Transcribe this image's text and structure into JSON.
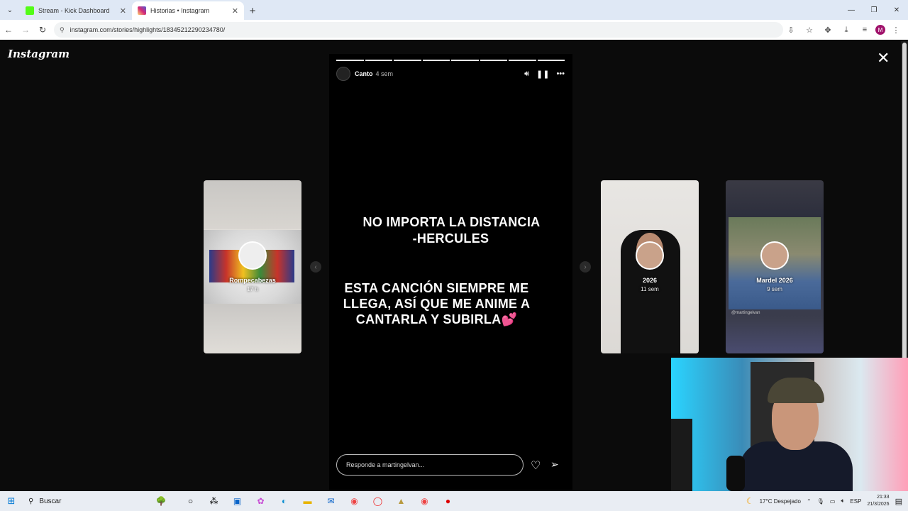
{
  "browser": {
    "tabs": [
      {
        "title": "Stream - Kick Dashboard",
        "favicon_color": "#53fc18"
      },
      {
        "title": "Historias • Instagram",
        "favicon_color": "#e1306c"
      }
    ],
    "url": "instagram.com/stories/highlights/18345212290234780/"
  },
  "instagram": {
    "logo": "Instagram",
    "story": {
      "username": "Canto",
      "time": "4 sem",
      "text_line1": "NO IMPORTA LA DISTANCIA",
      "text_line2": "-HERCULES",
      "text_line3": "ESTA CANCIÓN SIEMPRE ME",
      "text_line4": "LLEGA, ASÍ QUE ME ANIME A",
      "text_line5": "CANTARLA Y SUBIRLA💕",
      "reply_placeholder": "Responde a martingelvan...",
      "segments_total": 8,
      "segments_done": 8
    },
    "previews": [
      {
        "label": "Rompecabezas",
        "time": "17 h"
      },
      {
        "label": "2026",
        "time": "11 sem"
      },
      {
        "label": "Mardel 2026",
        "time": "9 sem",
        "caption": "@martingelvan"
      }
    ]
  },
  "taskbar": {
    "search_label": "Buscar",
    "weather": "17°C  Despejado",
    "lang": "ESP",
    "time": "21:33",
    "date": "21/3/2026"
  }
}
